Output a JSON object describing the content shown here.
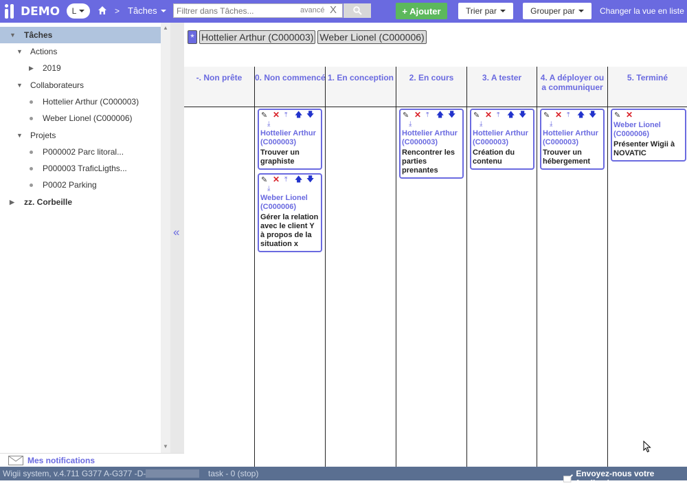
{
  "header": {
    "app_name": "DEMO",
    "lang_button": "L",
    "breadcrumb_sep": ">",
    "breadcrumb": "Tâches",
    "search_placeholder": "Filtrer dans Tâches...",
    "search_advanced": "avancé",
    "search_clear": "X",
    "add_button": "+ Ajouter",
    "sort_button": "Trier par",
    "group_button": "Grouper par",
    "change_view": "Changer la vue en liste"
  },
  "sidebar": {
    "items": [
      {
        "label": "Tâches"
      },
      {
        "label": "Actions"
      },
      {
        "label": "2019"
      },
      {
        "label": "Collaborateurs"
      },
      {
        "label": "Hottelier Arthur (C000003)"
      },
      {
        "label": "Weber Lionel (C000006)"
      },
      {
        "label": "Projets"
      },
      {
        "label": "P000002 Parc litoral..."
      },
      {
        "label": "P000003 TraficLigths..."
      },
      {
        "label": "P0002 Parking"
      },
      {
        "label": "zz. Corbeille"
      }
    ],
    "collapse": "«",
    "notifications": "Mes notifications"
  },
  "filters": {
    "star": "*",
    "chips": [
      "Hottelier Arthur (C000003)",
      "Weber Lionel (C000006)"
    ]
  },
  "board": {
    "columns": [
      {
        "title": "-. Non prête"
      },
      {
        "title": "0. Non commencé"
      },
      {
        "title": "1. En conception"
      },
      {
        "title": "2. En cours"
      },
      {
        "title": "3. A tester"
      },
      {
        "title": "4. A déployer ou a communiquer"
      },
      {
        "title": "5. Terminé"
      }
    ],
    "cards": [
      {
        "owner": "Hottelier Arthur (C000003)",
        "title": "Trouver un graphiste"
      },
      {
        "owner": "Weber Lionel (C000006)",
        "title": "Gérer la relation avec le client Y à propos de la situation x"
      },
      {
        "owner": "Hottelier Arthur (C000003)",
        "title": "Rencontrer les parties prenantes"
      },
      {
        "owner": "Hottelier Arthur (C000003)",
        "title": "Création du contenu"
      },
      {
        "owner": "Hottelier Arthur (C000003)",
        "title": "Trouver un hébergement"
      },
      {
        "owner": "Weber Lionel (C000006)",
        "title": "Présenter Wigii à NOVATIC"
      }
    ]
  },
  "status": {
    "system": "Wigii system, v.4.711 G377 A-G377 -D-",
    "task": "task -  0 (stop)",
    "feedback": "Envoyez-nous votre feedback"
  },
  "colors": {
    "brand": "#6a6ae0",
    "add": "#5cb85c",
    "delete": "#d9232a",
    "status_bar": "#5a6f91"
  }
}
